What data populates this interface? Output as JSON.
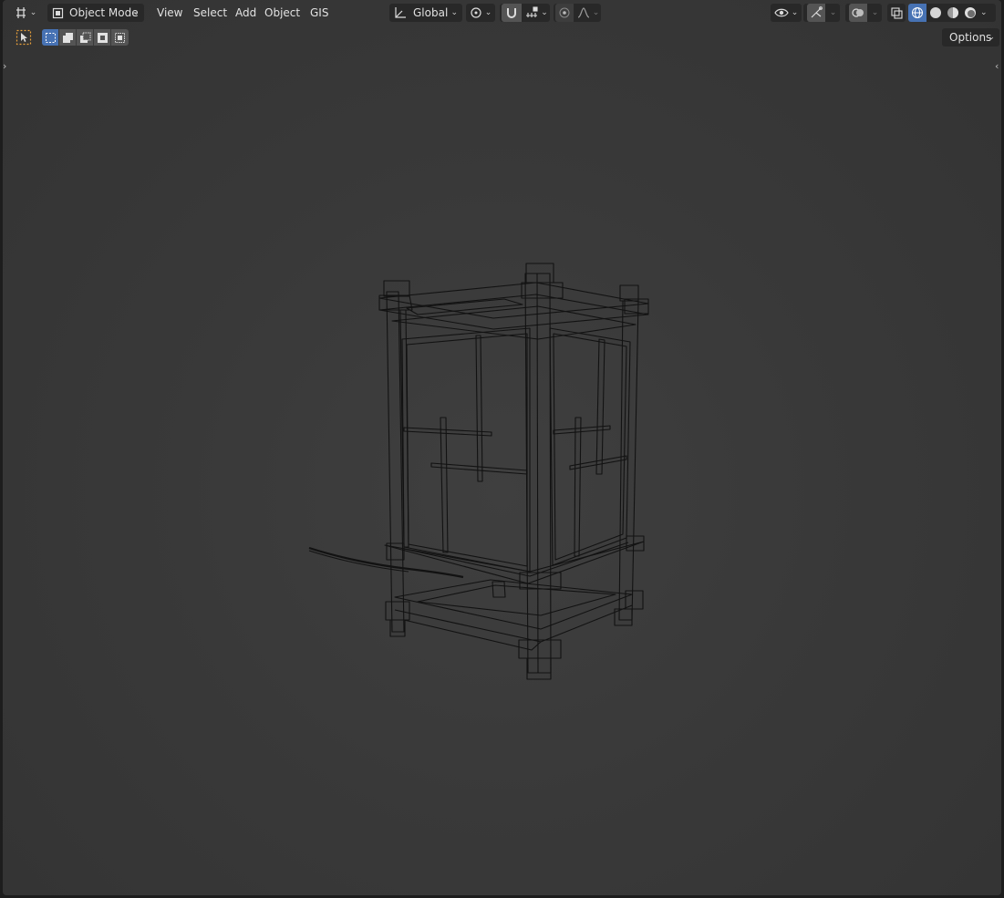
{
  "header": {
    "editor_type_icon": "editor-type-icon",
    "mode_label": "Object Mode",
    "menus": [
      "View",
      "Select",
      "Add",
      "Object",
      "GIS"
    ],
    "orientation_label": "Global"
  },
  "tool_settings": {
    "options_label": "Options"
  },
  "colors": {
    "viewport_bg": "#393939",
    "active_blue": "#4772b3",
    "header_btn": "#282828",
    "wire": "#141414"
  }
}
